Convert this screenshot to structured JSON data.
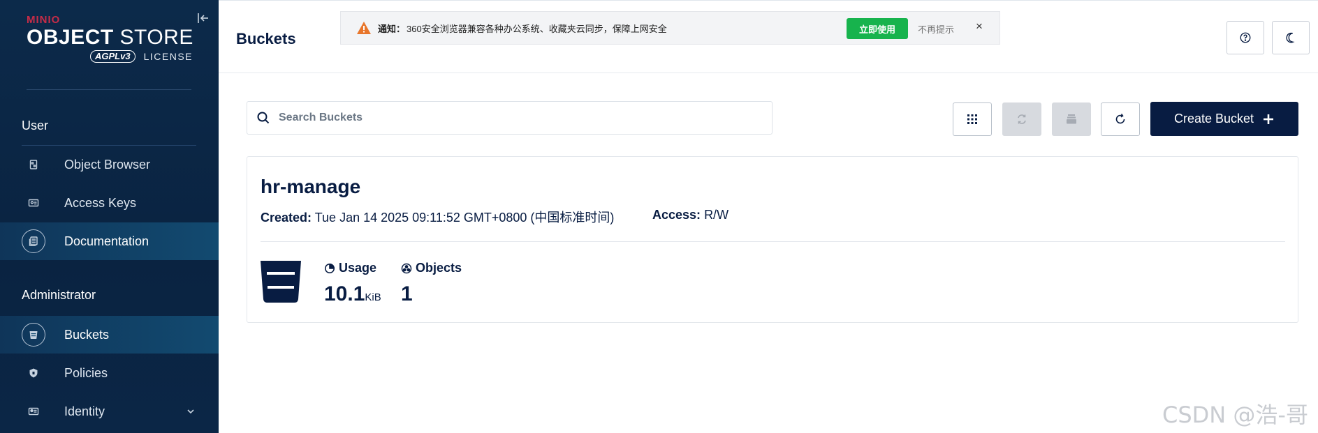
{
  "sidebar": {
    "logo": {
      "brand": "MINIO",
      "title_bold": "OBJECT",
      "title_light": "STORE",
      "badge": "AGPLv3",
      "license": "LICENSE"
    },
    "sections": [
      {
        "label": "User"
      },
      {
        "label": "Administrator"
      }
    ],
    "user_items": [
      {
        "label": "Object Browser",
        "icon": "object-browser-icon"
      },
      {
        "label": "Access Keys",
        "icon": "access-keys-icon"
      },
      {
        "label": "Documentation",
        "icon": "documentation-icon"
      }
    ],
    "admin_items": [
      {
        "label": "Buckets",
        "icon": "bucket-icon"
      },
      {
        "label": "Policies",
        "icon": "policies-icon"
      },
      {
        "label": "Identity",
        "icon": "identity-icon"
      }
    ]
  },
  "header": {
    "title": "Buckets",
    "notice": {
      "strong": "通知：",
      "text": "360安全浏览器兼容各种办公系统、收藏夹云同步，保障上网安全",
      "action": "立即使用",
      "dismiss": "不再提示",
      "close": "×"
    }
  },
  "toolbar": {
    "search_placeholder": "Search Buckets",
    "search_value": "",
    "create_label": "Create Bucket"
  },
  "bucket": {
    "name": "hr-manage",
    "created_label": "Created:",
    "created_value": "Tue Jan 14 2025 09:11:52 GMT+0800 (中国标准时间)",
    "access_label": "Access:",
    "access_value": "R/W",
    "usage_label": "Usage",
    "usage_value": "10.1",
    "usage_unit": "KiB",
    "objects_label": "Objects",
    "objects_value": "1"
  },
  "watermark": "CSDN @浩-哥",
  "colors": {
    "sidebar": "#0a2341",
    "primary": "#081c42",
    "notice_action": "#17b34d",
    "warning": "#e8762b"
  }
}
